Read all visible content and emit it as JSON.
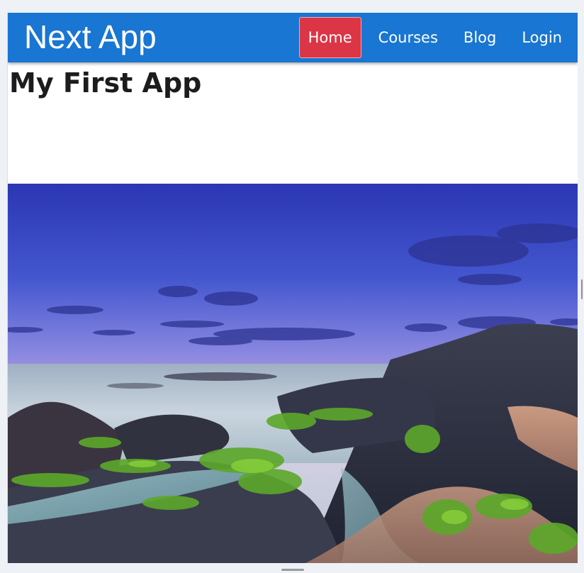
{
  "header": {
    "brand": "Next App",
    "nav_items": [
      {
        "label": "Home",
        "active": true
      },
      {
        "label": "Courses",
        "active": false
      },
      {
        "label": "Blog",
        "active": false
      },
      {
        "label": "Login",
        "active": false
      }
    ]
  },
  "main": {
    "title": "My First App"
  },
  "colors": {
    "navbar": "#1976d2",
    "active_nav": "#dc3545"
  }
}
